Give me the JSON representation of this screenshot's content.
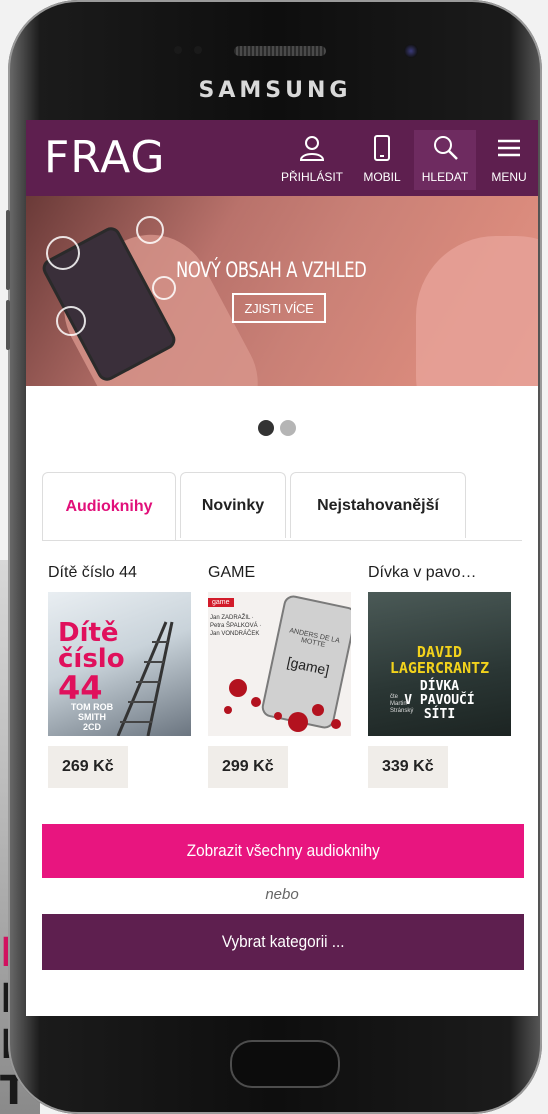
{
  "device": {
    "brand": "SAMSUNG"
  },
  "header": {
    "logo": "FRAG",
    "nav": [
      {
        "label": "PŘIHLÁSIT",
        "icon": "user-icon"
      },
      {
        "label": "MOBIL",
        "icon": "mobile-icon"
      },
      {
        "label": "HLEDAT",
        "icon": "search-icon"
      },
      {
        "label": "MENU",
        "icon": "hamburger-menu-icon"
      }
    ]
  },
  "banner": {
    "title": "NOVÝ OBSAH A VZHLED",
    "button_label": "ZJISTI VÍCE"
  },
  "carousel": {
    "active_index": 0,
    "count": 2
  },
  "tabs": [
    {
      "label": "Audioknihy",
      "active": true
    },
    {
      "label": "Novinky",
      "active": false
    },
    {
      "label": "Nejstahovanější",
      "active": false
    }
  ],
  "products": [
    {
      "title": "Dítě číslo 44",
      "price": "269 Kč",
      "cover": {
        "line1": "Dítě",
        "line2": "číslo",
        "line3": "44",
        "author": "TOM ROB SMITH",
        "format": "2CD"
      }
    },
    {
      "title": "GAME",
      "price": "299 Kč",
      "cover": {
        "series": "game",
        "author": "ANDERS DE LA MOTTE",
        "title": "[game]",
        "readers": "Jan ZADRAŽIL · Petra ŠPALKOVÁ · Jan VONDRÁČEK"
      }
    },
    {
      "title": "Dívka v pavo…",
      "price": "339 Kč",
      "cover": {
        "author_line1": "DAVID",
        "author_line2": "LAGERCRANTZ",
        "title_line1": "DÍVKA",
        "title_line2": "V PAVOUČÍ",
        "title_line3": "SÍTI",
        "reader_line1": "čte",
        "reader_line2": "Martin",
        "reader_line3": "Stránský"
      }
    }
  ],
  "actions": {
    "show_all": "Zobrazit všechny audioknihy",
    "or": "nebo",
    "choose_category": "Vybrat kategorii ..."
  },
  "colors": {
    "header_bg": "#5e1f4f",
    "primary_pink": "#e8157f",
    "category_purple": "#5e1f4f",
    "tab_active_text": "#e1107a"
  }
}
